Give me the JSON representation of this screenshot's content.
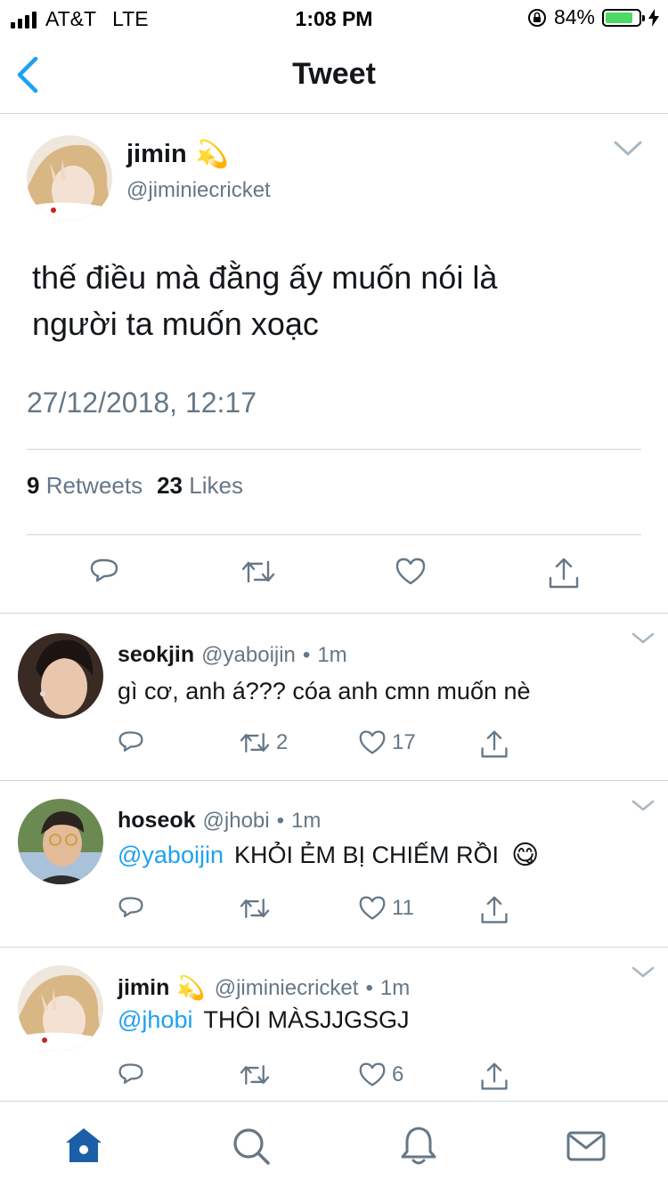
{
  "status_bar": {
    "carrier": "AT&T",
    "network": "LTE",
    "time": "1:08 PM",
    "battery": "84%",
    "battery_level": 0.84
  },
  "nav": {
    "title": "Tweet",
    "back_icon": "chevron-left-icon"
  },
  "tweet": {
    "name": "jimin",
    "emoji": "💫",
    "handle": "@jiminiecricket",
    "text_line1": "thế điều mà đằng ấy muốn nói là",
    "text_line2": "người ta muốn xoạc",
    "date": "27/12/2018, 12:17",
    "retweets_count": "9",
    "retweets_label": "Retweets",
    "likes_count": "23",
    "likes_label": "Likes"
  },
  "replies": [
    {
      "name": "seokjin",
      "handle": "@yaboijin",
      "dot": "•",
      "time": "1m",
      "mention": "",
      "text": "gì cơ, anh á??? cóa anh cmn muốn nè",
      "retweets": "2",
      "likes": "17"
    },
    {
      "name": "hoseok",
      "handle": "@jhobi",
      "dot": "•",
      "time": "1m",
      "mention": "@yaboijin",
      "text": "KHỎI ẺM BỊ CHIẾM RỒI",
      "emoji": "😋",
      "retweets": "",
      "likes": "11"
    },
    {
      "name": "jimin",
      "emoji": "💫",
      "handle": "@jiminiecricket",
      "dot": "•",
      "time": "1m",
      "mention": "@jhobi",
      "text": "THÔI MÀSJJGSGJ",
      "retweets": "",
      "likes": "6"
    }
  ],
  "tabbar": {
    "items": [
      "home-icon",
      "search-icon",
      "notifications-icon",
      "messages-icon"
    ],
    "active": "home-icon"
  },
  "colors": {
    "accent": "#1da1f2",
    "nav_accent": "#1da1f2",
    "text_secondary": "#657786",
    "divider": "#ced5dc",
    "tab_active": "#1b5fa8"
  }
}
